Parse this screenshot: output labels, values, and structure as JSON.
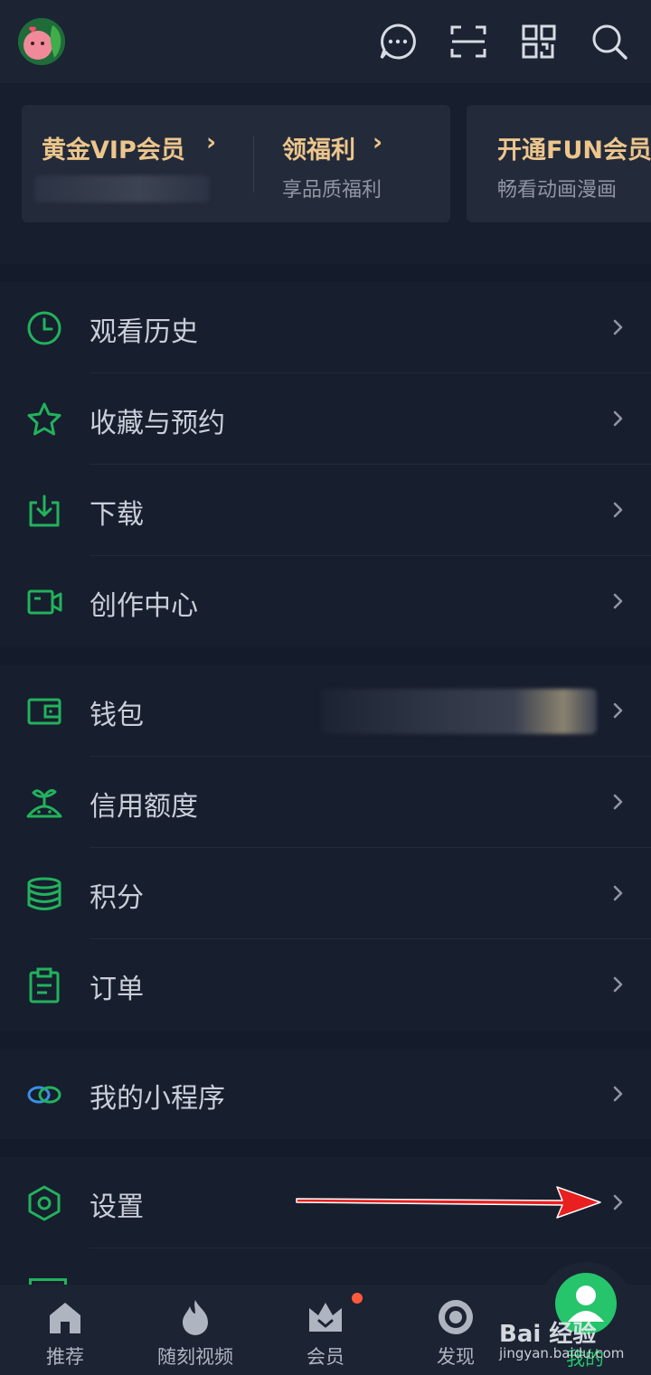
{
  "vip": {
    "gold_title": "黄金VIP会员",
    "welfare_title": "领福利",
    "welfare_sub": "享品质福利",
    "fun_title": "开通FUN会员",
    "fun_sub": "畅看动画漫画"
  },
  "groups": [
    {
      "items": [
        {
          "label": "观看历史",
          "icon": "clock-icon"
        },
        {
          "label": "收藏与预约",
          "icon": "star-icon"
        },
        {
          "label": "下载",
          "icon": "download-icon"
        },
        {
          "label": "创作中心",
          "icon": "video-camera-icon"
        }
      ]
    },
    {
      "items": [
        {
          "label": "钱包",
          "icon": "wallet-icon"
        },
        {
          "label": "信用额度",
          "icon": "sprout-icon"
        },
        {
          "label": "积分",
          "icon": "coins-icon"
        },
        {
          "label": "订单",
          "icon": "clipboard-icon"
        }
      ]
    },
    {
      "items": [
        {
          "label": "我的小程序",
          "icon": "link-rings-icon"
        }
      ]
    },
    {
      "items": [
        {
          "label": "设置",
          "icon": "hexagon-settings-icon"
        }
      ]
    }
  ],
  "nav": {
    "home": "推荐",
    "shorts": "随刻视频",
    "vip": "会员",
    "discover": "发现",
    "me": "我的"
  },
  "watermark": {
    "brand": "Bai 经验",
    "site": "jingyan.baidu.com"
  },
  "colors": {
    "accent_green": "#22b25c",
    "gold": "#ecc68c",
    "arrow_red": "#e8201f"
  }
}
